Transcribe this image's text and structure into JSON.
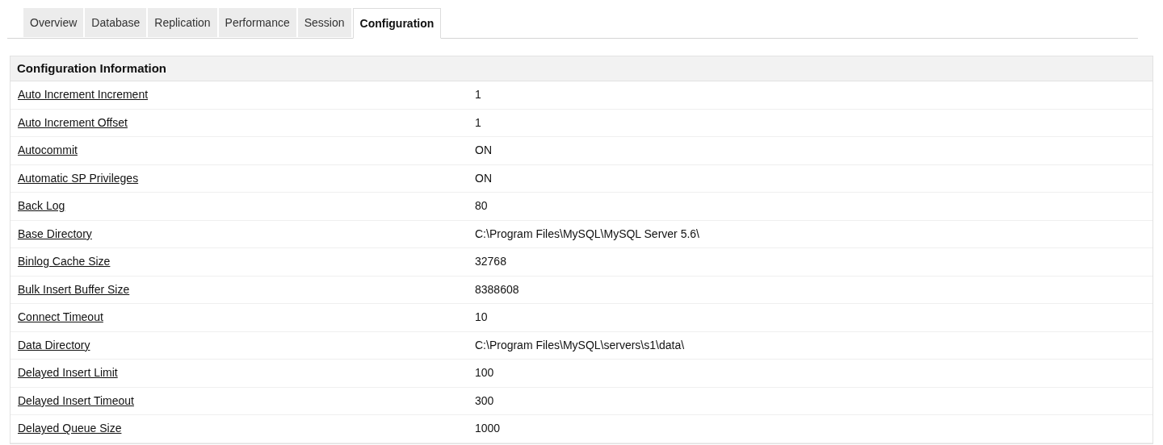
{
  "tabs": [
    {
      "label": "Overview",
      "selected": false
    },
    {
      "label": "Database",
      "selected": false
    },
    {
      "label": "Replication",
      "selected": false
    },
    {
      "label": "Performance",
      "selected": false
    },
    {
      "label": "Session",
      "selected": false
    },
    {
      "label": "Configuration",
      "selected": true
    }
  ],
  "panel": {
    "title": "Configuration Information",
    "rows": [
      {
        "name": "Auto Increment Increment",
        "value": "1"
      },
      {
        "name": "Auto Increment Offset",
        "value": "1"
      },
      {
        "name": "Autocommit",
        "value": "ON"
      },
      {
        "name": "Automatic SP Privileges",
        "value": "ON"
      },
      {
        "name": "Back Log",
        "value": "80"
      },
      {
        "name": "Base Directory",
        "value": "C:\\Program Files\\MySQL\\MySQL Server 5.6\\"
      },
      {
        "name": "Binlog Cache Size",
        "value": "32768"
      },
      {
        "name": "Bulk Insert Buffer Size",
        "value": "8388608"
      },
      {
        "name": "Connect Timeout",
        "value": "10"
      },
      {
        "name": "Data Directory",
        "value": "C:\\Program Files\\MySQL\\servers\\s1\\data\\"
      },
      {
        "name": "Delayed Insert Limit",
        "value": "100"
      },
      {
        "name": "Delayed Insert Timeout",
        "value": "300"
      },
      {
        "name": "Delayed Queue Size",
        "value": "1000"
      }
    ]
  }
}
